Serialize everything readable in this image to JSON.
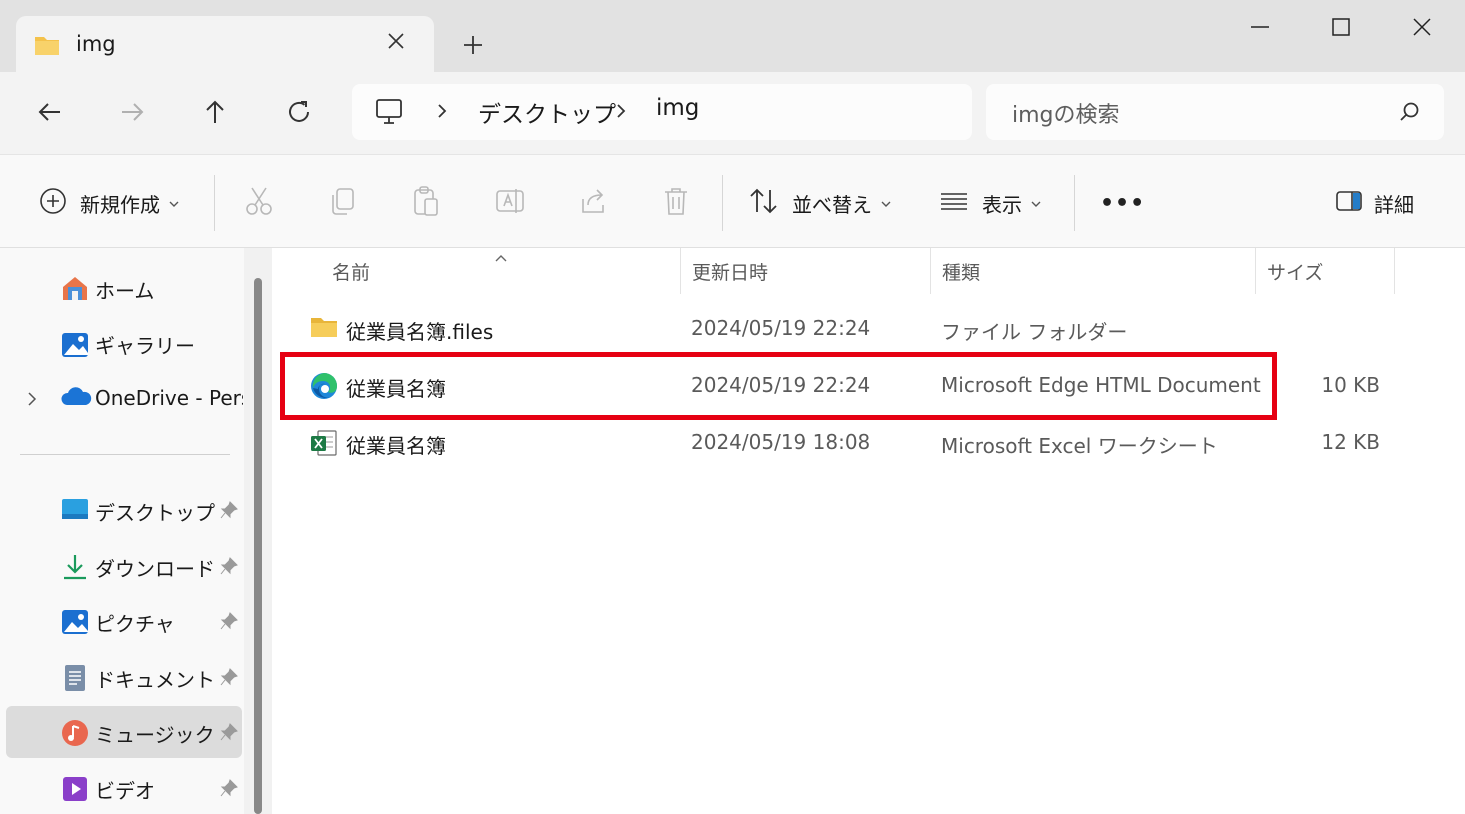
{
  "window": {
    "tab_title": "img",
    "new_tab_symbol": "+",
    "controls": [
      "minimize-icon",
      "maximize-icon",
      "close-icon"
    ]
  },
  "navigation": {
    "buttons": [
      "back-arrow-icon",
      "forward-arrow-icon",
      "up-arrow-icon",
      "refresh-icon"
    ],
    "breadcrumb": [
      "デスクトップ",
      "img"
    ],
    "search_placeholder": "imgの検索"
  },
  "commandbar": {
    "new_label": "新規作成",
    "sort_label": "並べ替え",
    "view_label": "表示",
    "more_label": "•••",
    "details_label": "詳細"
  },
  "sidebar": {
    "items": [
      {
        "label": "ホーム",
        "icon": "home-icon",
        "pinned": false
      },
      {
        "label": "ギャラリー",
        "icon": "gallery-icon",
        "pinned": false
      },
      {
        "label": "OneDrive - Personal",
        "icon": "cloud-icon",
        "pinned": false,
        "expandable": true
      },
      {
        "label": "デスクトップ",
        "icon": "desktop-icon",
        "pinned": true
      },
      {
        "label": "ダウンロード",
        "icon": "download-icon",
        "pinned": true
      },
      {
        "label": "ピクチャ",
        "icon": "pictures-icon",
        "pinned": true
      },
      {
        "label": "ドキュメント",
        "icon": "documents-icon",
        "pinned": true
      },
      {
        "label": "ミュージック",
        "icon": "music-icon",
        "pinned": true,
        "selected": true
      },
      {
        "label": "ビデオ",
        "icon": "video-icon",
        "pinned": true
      }
    ]
  },
  "filelist": {
    "columns": {
      "name": "名前",
      "modified": "更新日時",
      "type": "種類",
      "size": "サイズ"
    },
    "rows": [
      {
        "name": "従業員名簿.files",
        "modified": "2024/05/19 22:24",
        "type": "ファイル フォルダー",
        "size": "",
        "icon": "folder-icon"
      },
      {
        "name": "従業員名簿",
        "modified": "2024/05/19 22:24",
        "type": "Microsoft Edge HTML Document",
        "size": "10 KB",
        "icon": "edge-icon",
        "highlighted": true
      },
      {
        "name": "従業員名簿",
        "modified": "2024/05/19 18:08",
        "type": "Microsoft Excel ワークシート",
        "size": "12 KB",
        "icon": "excel-icon"
      }
    ]
  },
  "colors": {
    "highlight_border": "#e60012",
    "folder": "#f4c24b",
    "accent_blue": "#0067c0"
  }
}
